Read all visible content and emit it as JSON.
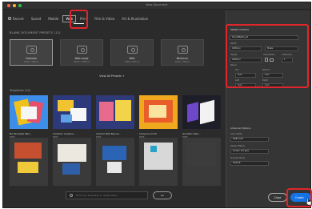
{
  "window": {
    "title": "New Document",
    "traffic_lights": [
      "#ff5f57",
      "#febc2e",
      "#28c840"
    ]
  },
  "nav": {
    "items": [
      {
        "label": "Recent"
      },
      {
        "label": "Saved"
      },
      {
        "label": "Mobile"
      },
      {
        "label": "Web"
      },
      {
        "label": "Print"
      },
      {
        "label": "Film & Video"
      },
      {
        "label": "Art & Illustration"
      }
    ],
    "active_index": 3
  },
  "presets": {
    "heading": "BLANK DOCUMENT PRESETS (12)",
    "items": [
      {
        "name": "Common",
        "size": "1366 x 768 px",
        "selected": true
      },
      {
        "name": "Web Large",
        "size": "1920 x 1080 px"
      },
      {
        "name": "Web",
        "size": "1280 x 800 px"
      },
      {
        "name": "Minimum",
        "size": "1024 x 768 px"
      }
    ],
    "view_all": "View All Presets +"
  },
  "templates": {
    "heading": "Templates (12)",
    "items": [
      {
        "name": "Bio Template Wed...",
        "badge": "FREE"
      },
      {
        "name": "Colorbloc Creative...",
        "badge": "FREE"
      },
      {
        "name": "Colorful Web Banner...",
        "badge": "FREE"
      },
      {
        "name": "Company UI Kit",
        "badge": "FREE"
      },
      {
        "name": "Isometric Web...",
        "badge": "FREE"
      }
    ]
  },
  "search": {
    "placeholder": "Find more templates on Adobe Stock",
    "button": "Go"
  },
  "panel": {
    "heading": "PRESET DETAILS",
    "name": "SocialMedia_ad",
    "width_label": "Width",
    "width": "1080 px",
    "units": "Pixels",
    "height_label": "Height",
    "height": "1080 px",
    "orientation_label": "Orientation",
    "artboards_label": "Artboards",
    "artboards": "1",
    "bleed_label": "Bleed",
    "top_label": "Top",
    "top": "0 px",
    "bottom_label": "Bottom",
    "bottom": "0 px",
    "left_label": "Left",
    "left": "0 px",
    "right_label": "Right",
    "right": "0 px",
    "advanced": "Advanced Options",
    "color_mode_label": "Color Mode",
    "color_mode": "RGB Color",
    "raster_label": "Raster Effects",
    "raster": "Screen (72 ppi)",
    "preview_label": "Preview Mode",
    "preview": "Default"
  },
  "actions": {
    "close": "Close",
    "create": "Create"
  },
  "colors": {
    "highlight": "#e0262c",
    "accent": "#1473e6"
  }
}
